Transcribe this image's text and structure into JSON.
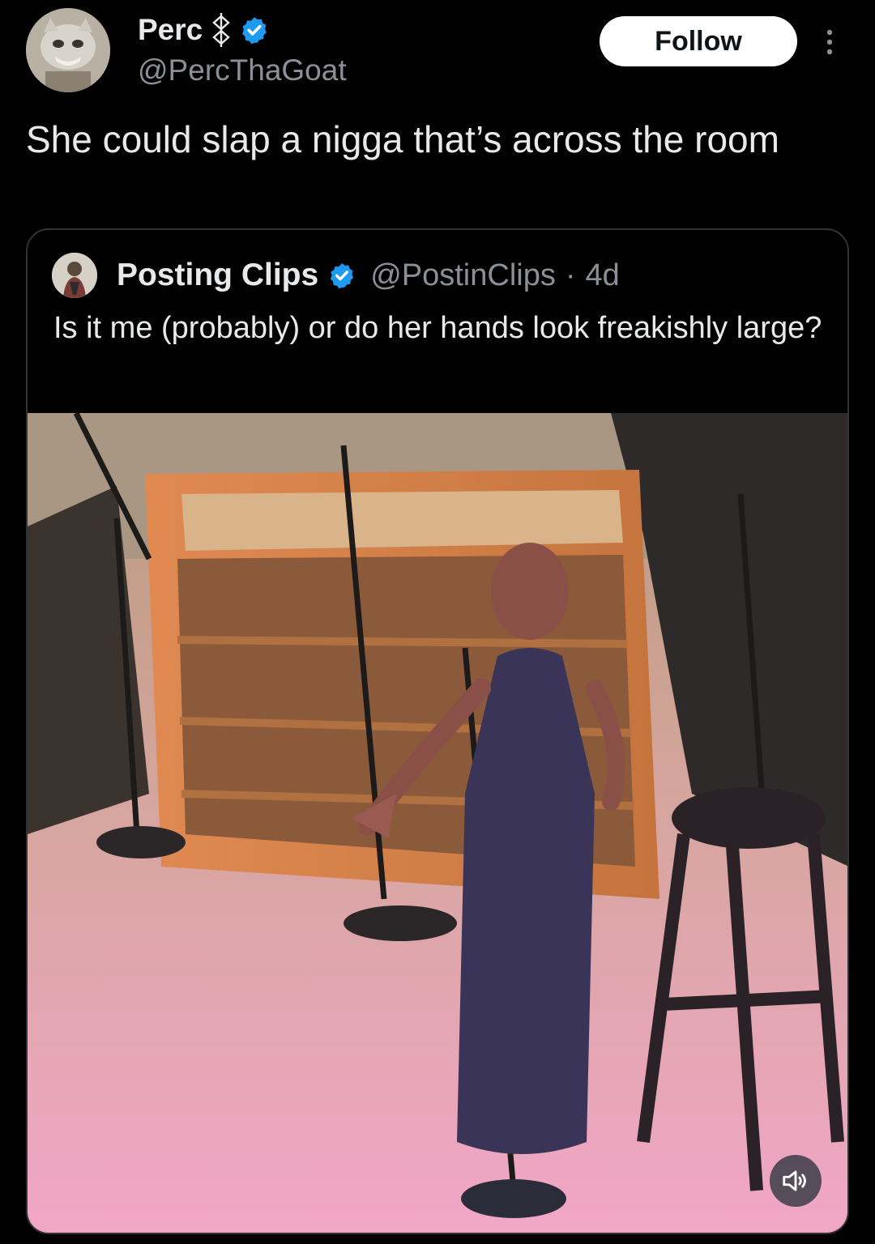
{
  "post": {
    "author": {
      "display_name": "Perc",
      "handle": "@PercThaGoat",
      "verified": true
    },
    "follow_label": "Follow",
    "text": "She could slap a nigga that’s across the room"
  },
  "quoted_post": {
    "author": {
      "display_name": "Posting Clips",
      "handle": "@PostinClips",
      "verified": true
    },
    "separator": "·",
    "time": "4d",
    "text": "Is it me (probably) or do her hands look freakishly large?",
    "media": {
      "type": "video",
      "volume_icon": "speaker-icon"
    }
  },
  "colors": {
    "background": "#000000",
    "text_primary": "#e7e9ea",
    "text_secondary": "#8b9097",
    "verified_blue": "#1d9bf0",
    "follow_bg": "#ffffff"
  }
}
